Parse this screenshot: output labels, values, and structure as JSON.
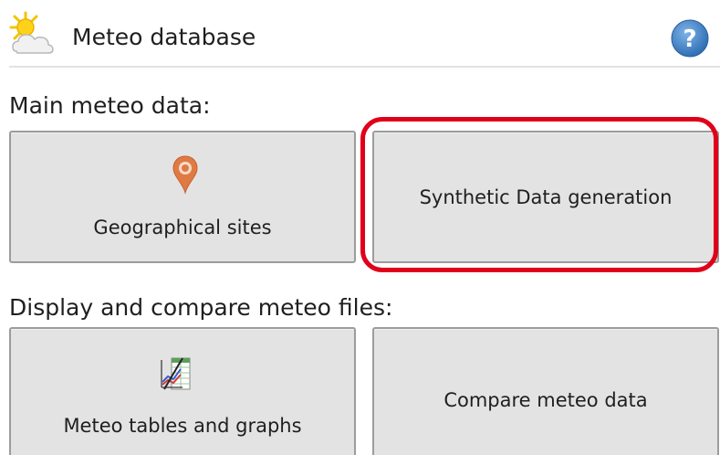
{
  "header": {
    "title": "Meteo database",
    "logo_icon": "sun-cloud-icon",
    "help_icon": "help-icon"
  },
  "sections": {
    "main": {
      "label": "Main meteo data:",
      "buttons": {
        "geo": {
          "label": "Geographical sites",
          "icon": "map-pin-icon"
        },
        "synthetic": {
          "label": "Synthetic Data generation",
          "highlighted": true
        }
      }
    },
    "display": {
      "label": "Display and compare meteo files:",
      "buttons": {
        "tables": {
          "label": "Meteo tables and graphs",
          "icon": "table-chart-icon"
        },
        "compare": {
          "label": "Compare meteo data"
        }
      }
    }
  },
  "colors": {
    "help": "#3b7fc4",
    "pin": "#e07a45",
    "highlight": "#e0001a",
    "tile_bg": "#e3e3e3",
    "tile_border": "#9c9c9c"
  }
}
